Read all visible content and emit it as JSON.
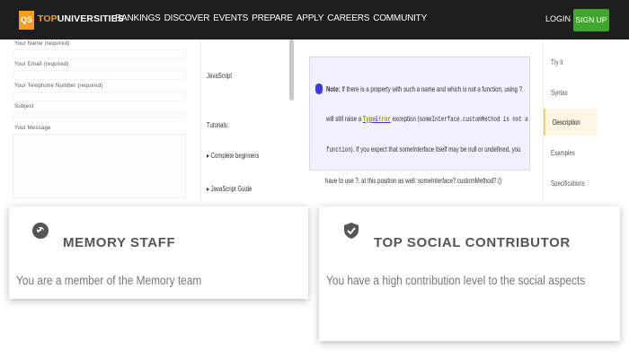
{
  "nav": {
    "logo_badge": "QS",
    "logo_top": "TOP",
    "logo_rest": "UNIVERSITIES",
    "links": [
      "RANKINGS",
      "DISCOVER",
      "EVENTS",
      "PREPARE",
      "APPLY",
      "CAREERS",
      "COMMUNITY"
    ],
    "login": "LOGIN",
    "signup": "SIGN UP"
  },
  "form": {
    "name_label": "Your Name (required)",
    "email_label": "Your Email (required)",
    "phone_label": "Your Telephone Number (required)",
    "subject_label": "Subject",
    "message_label": "Your Message"
  },
  "mdn_sidebar": {
    "heading": "JavaScript",
    "tutorials": "Tutorials:",
    "item1": "▸ Complete beginners",
    "item2": "▸ JavaScript Guide"
  },
  "note": {
    "label": "Note:",
    "line1": "If there is a property with such a name and which is not a function, using ?.",
    "line2a": "will still raise a",
    "type_error": "TypeError",
    "line2b": "exception (",
    "code1": "someInterface.customMethod is not a",
    "line3a": "function",
    "line3b": "). If you expect that someInterface itself may be null or undefined, you",
    "after": "have to use ?. at this position as well: someInterface?.customMethod?.()"
  },
  "toc": {
    "items": [
      "Try it",
      "Syntax",
      "Description",
      "Examples",
      "Specifications"
    ],
    "active_index": 2
  },
  "cards": [
    {
      "title": "MEMORY STAFF",
      "description": "You are a member of the Memory team",
      "icon": "brain-icon"
    },
    {
      "title": "TOP SOCIAL CONTRIBUTOR",
      "description": "You have a high contribution level to the social aspects",
      "icon": "shield-check-icon"
    }
  ],
  "colors": {
    "nav_bg": "#1e1e1e",
    "brand_orange": "#f39c1f",
    "signup_green": "#41a62e",
    "note_bg": "#f0f0fe",
    "note_accent": "#3b3bd6"
  }
}
